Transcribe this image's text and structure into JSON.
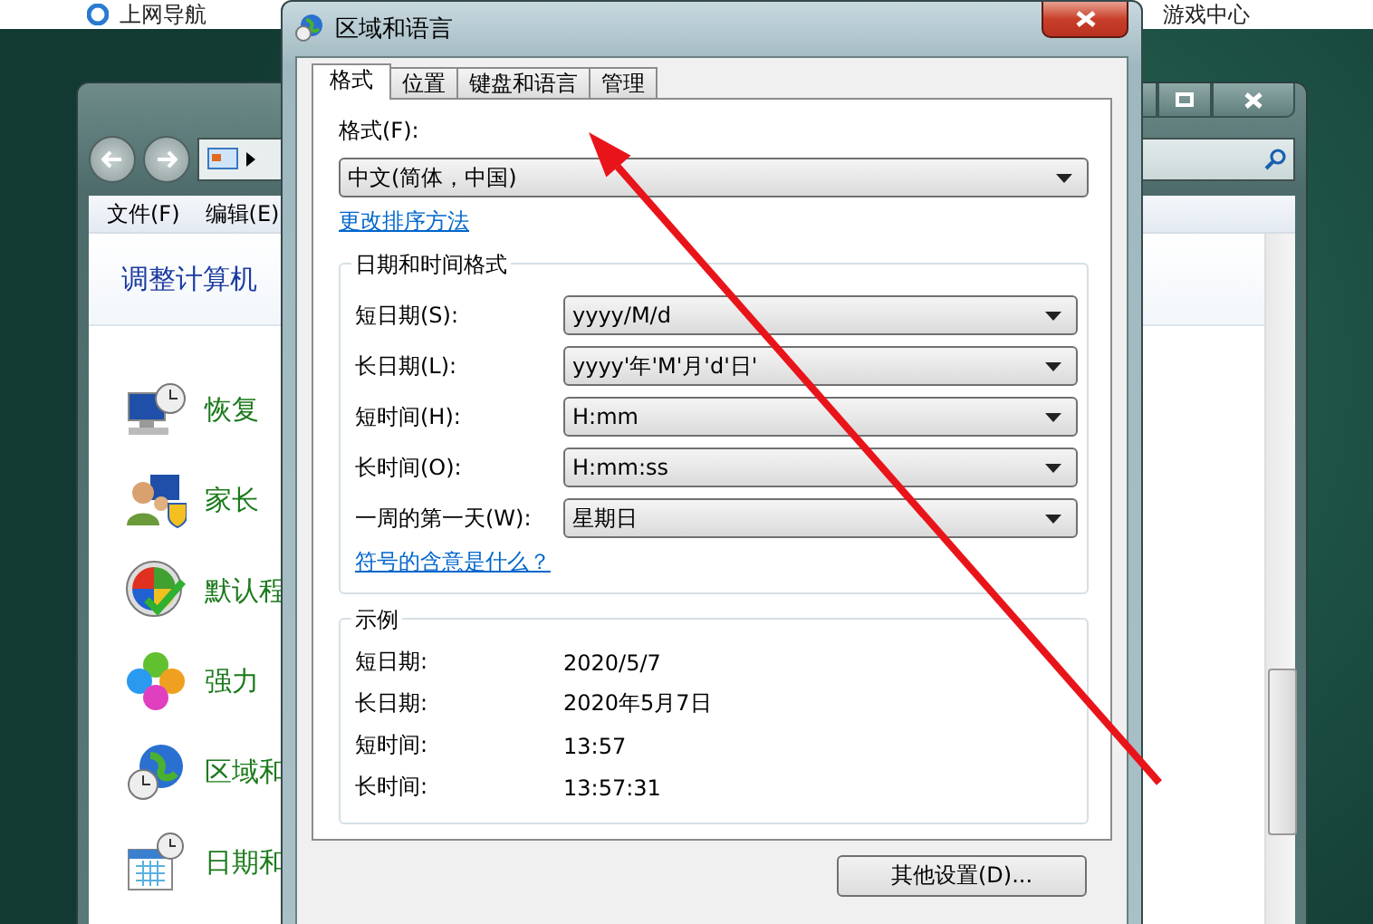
{
  "browser_bar": {
    "links": [
      "上网导航",
      "游戏中心"
    ]
  },
  "background_window": {
    "menu": [
      "文件(F)",
      "编辑(E)"
    ],
    "heading": "调整计算机",
    "items": [
      {
        "label": "恢复"
      },
      {
        "label": "家长"
      },
      {
        "label": "默认程"
      },
      {
        "label": "强力"
      },
      {
        "label": "区域和"
      },
      {
        "label": "日期和"
      }
    ]
  },
  "dialog": {
    "title": "区域和语言",
    "tabs": [
      {
        "label": "格式",
        "selected": true
      },
      {
        "label": "位置",
        "selected": false
      },
      {
        "label": "键盘和语言",
        "selected": false
      },
      {
        "label": "管理",
        "selected": false
      }
    ],
    "format_label": "格式(F):",
    "format_value": "中文(简体，中国)",
    "sort_link": "更改排序方法",
    "datetime_group": {
      "title": "日期和时间格式",
      "rows": [
        {
          "label": "短日期(S):",
          "value": "yyyy/M/d"
        },
        {
          "label": "长日期(L):",
          "value": "yyyy'年'M'月'd'日'"
        },
        {
          "label": "短时间(H):",
          "value": "H:mm"
        },
        {
          "label": "长时间(O):",
          "value": "H:mm:ss"
        },
        {
          "label": "一周的第一天(W):",
          "value": "星期日"
        }
      ],
      "help_link": "符号的含意是什么？"
    },
    "examples": {
      "title": "示例",
      "rows": [
        {
          "label": "短日期:",
          "value": "2020/5/7"
        },
        {
          "label": "长日期:",
          "value": "2020年5月7日"
        },
        {
          "label": "短时间:",
          "value": "13:57"
        },
        {
          "label": "长时间:",
          "value": "13:57:31"
        }
      ]
    },
    "button": "其他设置(D)..."
  }
}
